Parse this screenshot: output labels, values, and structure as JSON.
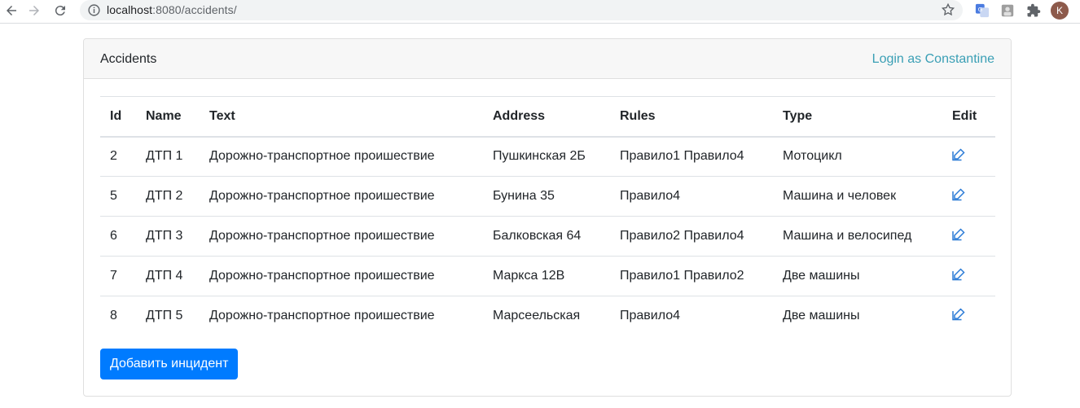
{
  "browser": {
    "url_host": "localhost",
    "url_rest": ":8080/accidents/",
    "avatar_letter": "K"
  },
  "header": {
    "title": "Accidents",
    "login_text": "Login as Constantine"
  },
  "table": {
    "columns": [
      "Id",
      "Name",
      "Text",
      "Address",
      "Rules",
      "Type",
      "Edit"
    ],
    "rows": [
      {
        "id": "2",
        "name": "ДТП 1",
        "text": "Дорожно-транспортное проишествие",
        "address": "Пушкинская 2Б",
        "rules": "Правило1 Правило4",
        "type": "Мотоцикл"
      },
      {
        "id": "5",
        "name": "ДТП 2",
        "text": "Дорожно-транспортное проишествие",
        "address": "Бунина 35",
        "rules": "Правило4",
        "type": "Машина и человек"
      },
      {
        "id": "6",
        "name": "ДТП 3",
        "text": "Дорожно-транспортное проишествие",
        "address": "Балковская 64",
        "rules": "Правило2 Правило4",
        "type": "Машина и велосипед"
      },
      {
        "id": "7",
        "name": "ДТП 4",
        "text": "Дорожно-транспортное проишествие",
        "address": "Маркса 12В",
        "rules": "Правило1 Правило2",
        "type": "Две машины"
      },
      {
        "id": "8",
        "name": "ДТП 5",
        "text": "Дорожно-транспортное проишествие",
        "address": "Марсеельская",
        "rules": "Правило4",
        "type": "Две машины"
      }
    ]
  },
  "actions": {
    "add_label": "Добавить инцидент"
  },
  "colors": {
    "primary": "#007bff",
    "link": "#3a9fb5",
    "edit_icon": "#2b7bd6"
  }
}
